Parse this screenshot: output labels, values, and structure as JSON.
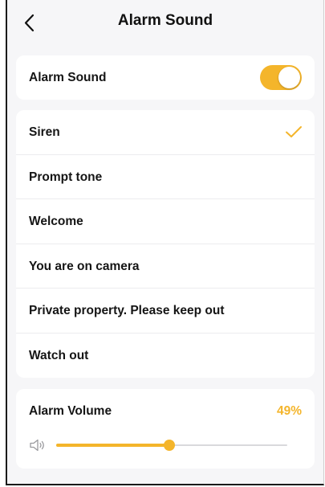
{
  "header": {
    "title": "Alarm Sound",
    "back_icon": "chevron-left-icon"
  },
  "alarm_toggle": {
    "label": "Alarm Sound",
    "on": true
  },
  "sounds": {
    "selected": "Siren",
    "items": [
      {
        "label": "Siren",
        "selected": true
      },
      {
        "label": "Prompt tone",
        "selected": false
      },
      {
        "label": "Welcome",
        "selected": false
      },
      {
        "label": "You are on camera",
        "selected": false
      },
      {
        "label": "Private property. Please keep out",
        "selected": false
      },
      {
        "label": "Watch out",
        "selected": false
      }
    ]
  },
  "volume": {
    "label": "Alarm Volume",
    "value_text": "49%",
    "level": 0.49,
    "icon": "speaker-icon"
  },
  "colors": {
    "accent": "#f4b52b",
    "background": "#f6f6f8",
    "card": "#ffffff",
    "text": "#151515"
  }
}
